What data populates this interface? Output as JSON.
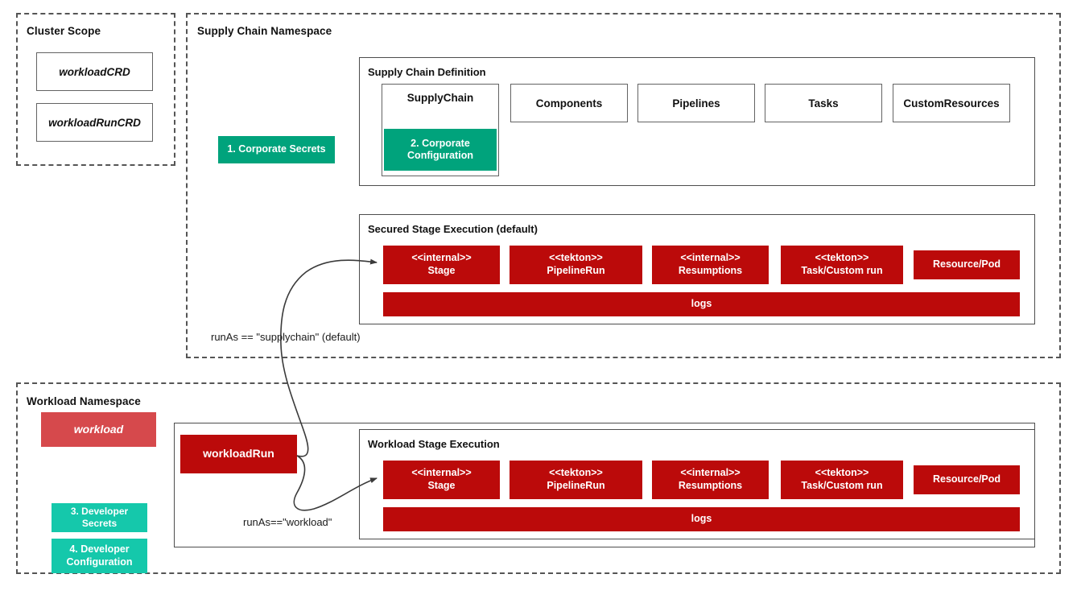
{
  "colors": {
    "green_dark": "#00a37c",
    "green_bright": "#15c8ab",
    "red_dark": "#bb0a0a",
    "red_light": "#d6494c",
    "border_gray": "#636363",
    "dash_gray": "#555555",
    "text_dark": "#111111"
  },
  "cluster_scope": {
    "title": "Cluster Scope",
    "items": [
      {
        "label": "workloadCRD"
      },
      {
        "label": "workloadRunCRD"
      }
    ]
  },
  "supply_chain_namespace": {
    "title": "Supply Chain Namespace",
    "corporate_secrets": "1. Corporate Secrets",
    "definition": {
      "title": "Supply Chain Definition",
      "supplychain": {
        "label": "SupplyChain",
        "corporate_configuration_line1": "2. Corporate",
        "corporate_configuration_line2": "Configuration"
      },
      "items": [
        {
          "label": "Components"
        },
        {
          "label": "Pipelines"
        },
        {
          "label": "Tasks"
        },
        {
          "label": "CustomResources"
        }
      ]
    },
    "secured_stage_execution": {
      "title": "Secured Stage Execution (default)",
      "stages": [
        {
          "line1": "<<internal>>",
          "line2": "Stage"
        },
        {
          "line1": "<<tekton>>",
          "line2": "PipelineRun"
        },
        {
          "line1": "<<internal>>",
          "line2": "Resumptions"
        },
        {
          "line1": "<<tekton>>",
          "line2": "Task/Custom run"
        },
        {
          "line1": "Resource/Pod",
          "line2": ""
        }
      ],
      "logs_label": "logs"
    },
    "runas_label": "runAs == \"supplychain\" (default)"
  },
  "workload_namespace": {
    "title": "Workload Namespace",
    "workload_label": "workload",
    "developer_secrets": "3. Developer Secrets",
    "developer_configuration_line1": "4. Developer",
    "developer_configuration_line2": "Configuration",
    "workload_run_label": "workloadRun",
    "runas_label": "runAs==\"workload\"",
    "stage_execution": {
      "title": "Workload Stage Execution",
      "stages": [
        {
          "line1": "<<internal>>",
          "line2": "Stage"
        },
        {
          "line1": "<<tekton>>",
          "line2": "PipelineRun"
        },
        {
          "line1": "<<internal>>",
          "line2": "Resumptions"
        },
        {
          "line1": "<<tekton>>",
          "line2": "Task/Custom run"
        },
        {
          "line1": "Resource/Pod",
          "line2": ""
        }
      ],
      "logs_label": "logs"
    }
  }
}
